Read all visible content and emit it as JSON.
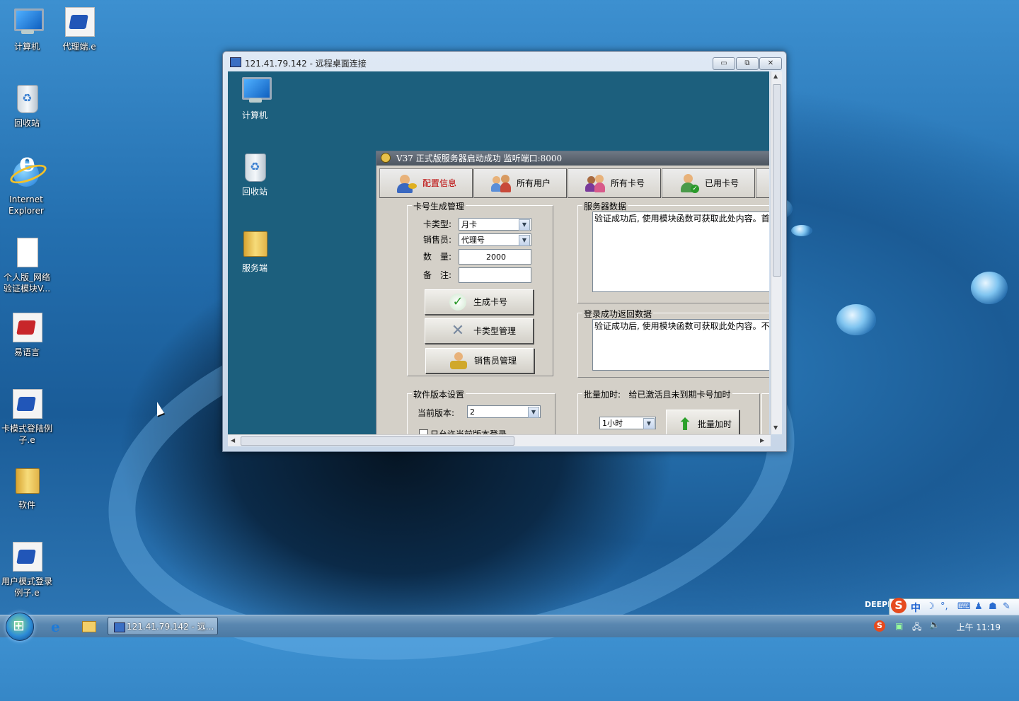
{
  "desktop": {
    "icons": [
      {
        "label": "计算机"
      },
      {
        "label": "代理端.e"
      },
      {
        "label": "回收站"
      },
      {
        "label": "Internet Explorer"
      },
      {
        "label": "个人版_网络验证模块V..."
      },
      {
        "label": "易语言"
      },
      {
        "label": "卡模式登陆例子.e"
      },
      {
        "label": "软件"
      },
      {
        "label": "用户模式登录例子.e"
      }
    ]
  },
  "rdp": {
    "title": "121.41.79.142 - 远程桌面连接",
    "buttons": {
      "minimize": "▭",
      "restore": "⧉",
      "close": "✕"
    },
    "remote_icons": [
      {
        "label": "计算机"
      },
      {
        "label": "回收站"
      },
      {
        "label": "服务端"
      }
    ],
    "app": {
      "title": "V37  正式版服务器启动成功    监听端口:8000",
      "tabs": [
        {
          "label": "配置信息"
        },
        {
          "label": "所有用户"
        },
        {
          "label": "所有卡号"
        },
        {
          "label": "已用卡号"
        }
      ],
      "card_group": {
        "title": "卡号生成管理",
        "card_type_label": "卡类型:",
        "card_type_value": "月卡",
        "seller_label": "销售员:",
        "seller_value": "代理号",
        "quantity_label": "数　量:",
        "quantity_value": "2000",
        "note_label": "备　注:",
        "note_value": "",
        "btn_generate": "生成卡号",
        "btn_card_types": "卡类型管理",
        "btn_sellers": "销售员管理"
      },
      "server_data": {
        "title": "服务器数据",
        "text": "验证成功后, 使用模块函数可获取此处内容。首次"
      },
      "login_data": {
        "title": "登录成功返回数据",
        "text": "验证成功后, 使用模块函数可获取此处内容。不同"
      },
      "version_group": {
        "title": "软件版本设置",
        "current_label": "当前版本:",
        "current_value": "2",
        "checkbox_label": "只允许当前版本登录"
      },
      "batch": {
        "title": "批量加时:",
        "description": "给已激活且未到期卡号加时",
        "duration_value": "1小时",
        "btn_label": "批量加时"
      }
    }
  },
  "taskbar": {
    "task_label": "121.41.79.142 - 远...",
    "clock": "上午 11:19",
    "ime_zh": "中",
    "deepin": "DEEPIN"
  },
  "colors": {
    "remote_desktop_bg": "#1c5f7d",
    "app_face": "#d4d0c8",
    "active_tab_text": "#bb0000"
  }
}
